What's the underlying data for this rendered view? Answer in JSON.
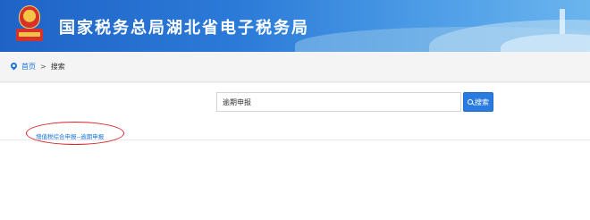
{
  "header": {
    "site_title": "国家税务总局湖北省电子税务局",
    "emblem_icon": "tax-emblem-icon",
    "colors": {
      "banner_start": "#1f63c6",
      "banner_end": "#6bb5ee"
    }
  },
  "breadcrumb": {
    "icon": "location-pin-icon",
    "home_label": "首页",
    "separator": ">",
    "current_label": "搜索"
  },
  "search": {
    "value": "逾期申报",
    "button_icon": "search-icon",
    "button_label": "搜索",
    "button_color": "#2a7be0"
  },
  "results": [
    {
      "text": "增值税综合申报--逾期申报",
      "color": "#1a73d9"
    }
  ],
  "annotation": {
    "color": "#d9242a",
    "shape": "ellipse"
  }
}
